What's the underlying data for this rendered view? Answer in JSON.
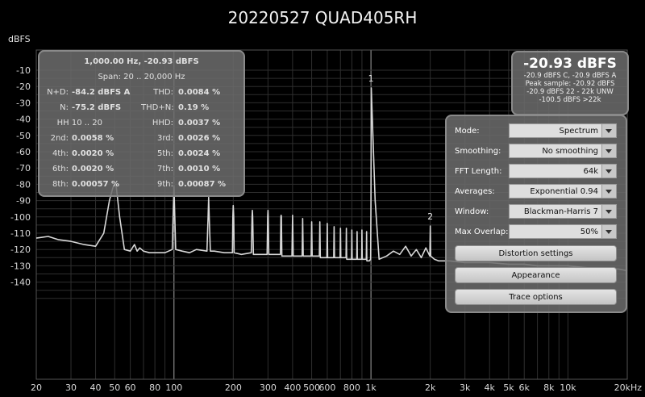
{
  "window": {
    "title": "20220527 QUAD405RH"
  },
  "stats": {
    "header": "1,000.00 Hz, -20.93 dBFS",
    "span": "Span: 20 .. 20,000 Hz",
    "rows": [
      {
        "l1": "N+D:",
        "v1": "-84.2 dBFS A",
        "l2": "THD:",
        "v2": "0.0084 %"
      },
      {
        "l1": "N:",
        "v1": "-75.2 dBFS",
        "l2": "THD+N:",
        "v2": "0.19 %"
      },
      {
        "l1": "HH 10 .. 20",
        "v1": "",
        "l2": "HHD:",
        "v2": "0.0037 %"
      },
      {
        "l1": "2nd:",
        "v1": "0.0058 %",
        "l2": "3rd:",
        "v2": "0.0026 %"
      },
      {
        "l1": "4th:",
        "v1": "0.0020 %",
        "l2": "5th:",
        "v2": "0.0024 %"
      },
      {
        "l1": "6th:",
        "v1": "0.0020 %",
        "l2": "7th:",
        "v2": "0.0010 %"
      },
      {
        "l1": "8th:",
        "v1": "0.00057 %",
        "l2": "9th:",
        "v2": "0.00087 %"
      }
    ]
  },
  "level": {
    "main": "-20.93 dBFS",
    "line1": "-20.9 dBFS C, -20.9 dBFS A",
    "line2": "Peak sample: -20.92 dBFS",
    "line3": "-20.9 dBFS 22 - 22k UNW",
    "line4": "-100.5 dBFS >22k"
  },
  "settings": {
    "dropdowns": [
      {
        "label": "Mode:",
        "value": "Spectrum"
      },
      {
        "label": "Smoothing:",
        "value": "No  smoothing"
      },
      {
        "label": "FFT Length:",
        "value": "64k"
      },
      {
        "label": "Averages:",
        "value": "Exponential 0.94"
      },
      {
        "label": "Window:",
        "value": "Blackman-Harris 7"
      },
      {
        "label": "Max Overlap:",
        "value": "50%"
      }
    ],
    "buttons": [
      "Distortion settings",
      "Appearance",
      "Trace options"
    ]
  },
  "colors": {
    "background": "#000000",
    "trace": "#d8d8d8",
    "grid": "#2e2e2e",
    "panel": "#6c6c6c"
  },
  "chart_data": {
    "type": "line",
    "title": "20220527 QUAD405RH",
    "ylabel": "dBFS",
    "xscale": "log",
    "xlim": [
      20,
      20000
    ],
    "ylim": [
      -150,
      -0.6
    ],
    "x_tick_labels": [
      "20",
      "30",
      "40",
      "50",
      "60",
      "80",
      "100",
      "200",
      "300",
      "400",
      "500",
      "600",
      "800",
      "1k",
      "2k",
      "3k",
      "4k",
      "5k",
      "6k",
      "8k",
      "10k",
      "20kHz"
    ],
    "x_tick_values": [
      20,
      30,
      40,
      50,
      60,
      80,
      100,
      200,
      300,
      400,
      500,
      600,
      800,
      1000,
      2000,
      3000,
      4000,
      5000,
      6000,
      8000,
      10000,
      20000
    ],
    "y_ticks": [
      -10,
      -20,
      -30,
      -40,
      -50,
      -60,
      -70,
      -80,
      -90,
      -100,
      -110,
      -120,
      -130,
      -140
    ],
    "grid": true,
    "markers": [
      {
        "label": "1",
        "x": 1000,
        "y": -20.9
      },
      {
        "label": "2",
        "x": 2000,
        "y": -105.6
      }
    ],
    "series": [
      {
        "x": [
          20,
          23,
          26,
          30,
          35,
          40,
          44,
          47,
          49,
          50,
          51,
          53,
          56,
          60,
          63,
          65,
          67,
          70,
          75,
          80,
          90,
          98,
          99,
          100,
          101,
          102,
          110,
          120,
          130,
          147,
          149,
          150,
          151,
          153,
          160,
          180,
          198,
          199,
          200,
          201,
          202,
          220,
          247,
          249,
          250,
          251,
          253,
          280,
          297,
          299,
          300,
          301,
          303,
          330,
          347,
          349,
          350,
          351,
          353,
          380,
          397,
          400,
          403,
          430,
          447,
          450,
          453,
          480,
          497,
          500,
          503,
          530,
          547,
          550,
          553,
          580,
          597,
          600,
          603,
          630,
          647,
          650,
          653,
          680,
          697,
          700,
          703,
          730,
          747,
          750,
          753,
          780,
          797,
          800,
          803,
          830,
          847,
          850,
          853,
          880,
          897,
          900,
          903,
          930,
          947,
          950,
          953,
          980,
          996,
          1000,
          1004,
          1050,
          1100,
          1200,
          1300,
          1400,
          1500,
          1600,
          1700,
          1800,
          1900,
          1990,
          2000,
          2010,
          2100,
          2200,
          2500,
          3000,
          4000,
          5000,
          6000,
          7000,
          8000,
          10000,
          12000,
          15000,
          18000,
          20000
        ],
        "y": [
          -113,
          -112,
          -114,
          -115,
          -117,
          -118,
          -110,
          -90,
          -82,
          -80,
          -82,
          -100,
          -120,
          -121,
          -117,
          -121,
          -119,
          -121,
          -122,
          -122,
          -122,
          -120,
          -100,
          -81,
          -100,
          -120,
          -121,
          -122,
          -120,
          -121,
          -100,
          -88,
          -100,
          -121,
          -121,
          -122,
          -122,
          -100,
          -93,
          -100,
          -122,
          -123,
          -122,
          -100,
          -96,
          -100,
          -123,
          -123,
          -123,
          -100,
          -96,
          -100,
          -123,
          -123,
          -123,
          -100,
          -99,
          -100,
          -124,
          -124,
          -124,
          -99,
          -124,
          -124,
          -124,
          -101,
          -124,
          -124,
          -124,
          -103,
          -124,
          -124,
          -124,
          -103,
          -125,
          -125,
          -125,
          -104,
          -125,
          -125,
          -125,
          -106,
          -125,
          -125,
          -125,
          -107,
          -125,
          -125,
          -125,
          -107,
          -126,
          -126,
          -126,
          -108,
          -126,
          -126,
          -126,
          -109,
          -126,
          -126,
          -126,
          -108,
          -126,
          -126,
          -126,
          -109,
          -127,
          -127,
          -126,
          -90,
          -20.9,
          -90,
          -126,
          -124,
          -121,
          -123,
          -118,
          -124,
          -120,
          -125,
          -119,
          -124,
          -105.6,
          -124,
          -126,
          -127,
          -127,
          -128,
          -128,
          -129,
          -129,
          -130,
          -130,
          -130,
          -131,
          -132,
          -132,
          -133
        ]
      }
    ]
  }
}
